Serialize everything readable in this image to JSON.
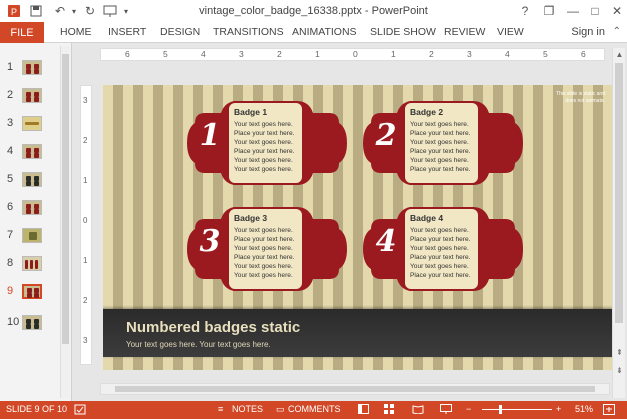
{
  "window": {
    "title": "vintage_color_badge_16338.pptx - PowerPoint"
  },
  "titlebar": {
    "help": "?",
    "restore": "❐",
    "minimize": "—",
    "maximize": "□",
    "close": "✕"
  },
  "ribbon": {
    "file": "FILE",
    "tabs": [
      "HOME",
      "INSERT",
      "DESIGN",
      "TRANSITIONS",
      "ANIMATIONS",
      "SLIDE SHOW",
      "REVIEW",
      "VIEW"
    ],
    "sign_in": "Sign in"
  },
  "slides_panel": {
    "numbers": [
      "1",
      "2",
      "3",
      "4",
      "5",
      "6",
      "7",
      "8",
      "9",
      "10"
    ],
    "selected": "9"
  },
  "ruler": {
    "h": [
      "6",
      "5",
      "4",
      "3",
      "2",
      "1",
      "0",
      "1",
      "2",
      "3",
      "4",
      "5",
      "6"
    ],
    "v": [
      "3",
      "2",
      "1",
      "0",
      "1",
      "2",
      "3"
    ]
  },
  "slide": {
    "note": "This slide is static and does not animate.",
    "badges": [
      {
        "number": "1",
        "title": "Badge 1",
        "text": "Your text goes here. Place your text here. Your text goes here. Place your text here. Your text goes here. Your text goes here."
      },
      {
        "number": "2",
        "title": "Badge 2",
        "text": "Your text goes here. Place your text here. Your text goes here. Place your text here. Your text goes here. Place your text here."
      },
      {
        "number": "3",
        "title": "Badge 3",
        "text": "Your text goes here. Place your text here. Your text goes here. Place your text here. Your text goes here. Your text goes here."
      },
      {
        "number": "4",
        "title": "Badge 4",
        "text": "Your text goes here. Place your text here. Your text goes here. Place your text here. Your text goes here. Place your text here."
      }
    ],
    "title": "Numbered badges static",
    "subtitle": "Your text goes here. Your text goes here."
  },
  "statusbar": {
    "slide_info": "SLIDE 9 OF 10",
    "notes": "NOTES",
    "comments": "COMMENTS",
    "zoom_minus": "−",
    "zoom_plus": "+",
    "zoom": "51%",
    "zoom_level": 0.51
  },
  "colors": {
    "accent": "#d24726",
    "badge_red": "#9b1a1f",
    "panel": "#f1e7c4"
  }
}
